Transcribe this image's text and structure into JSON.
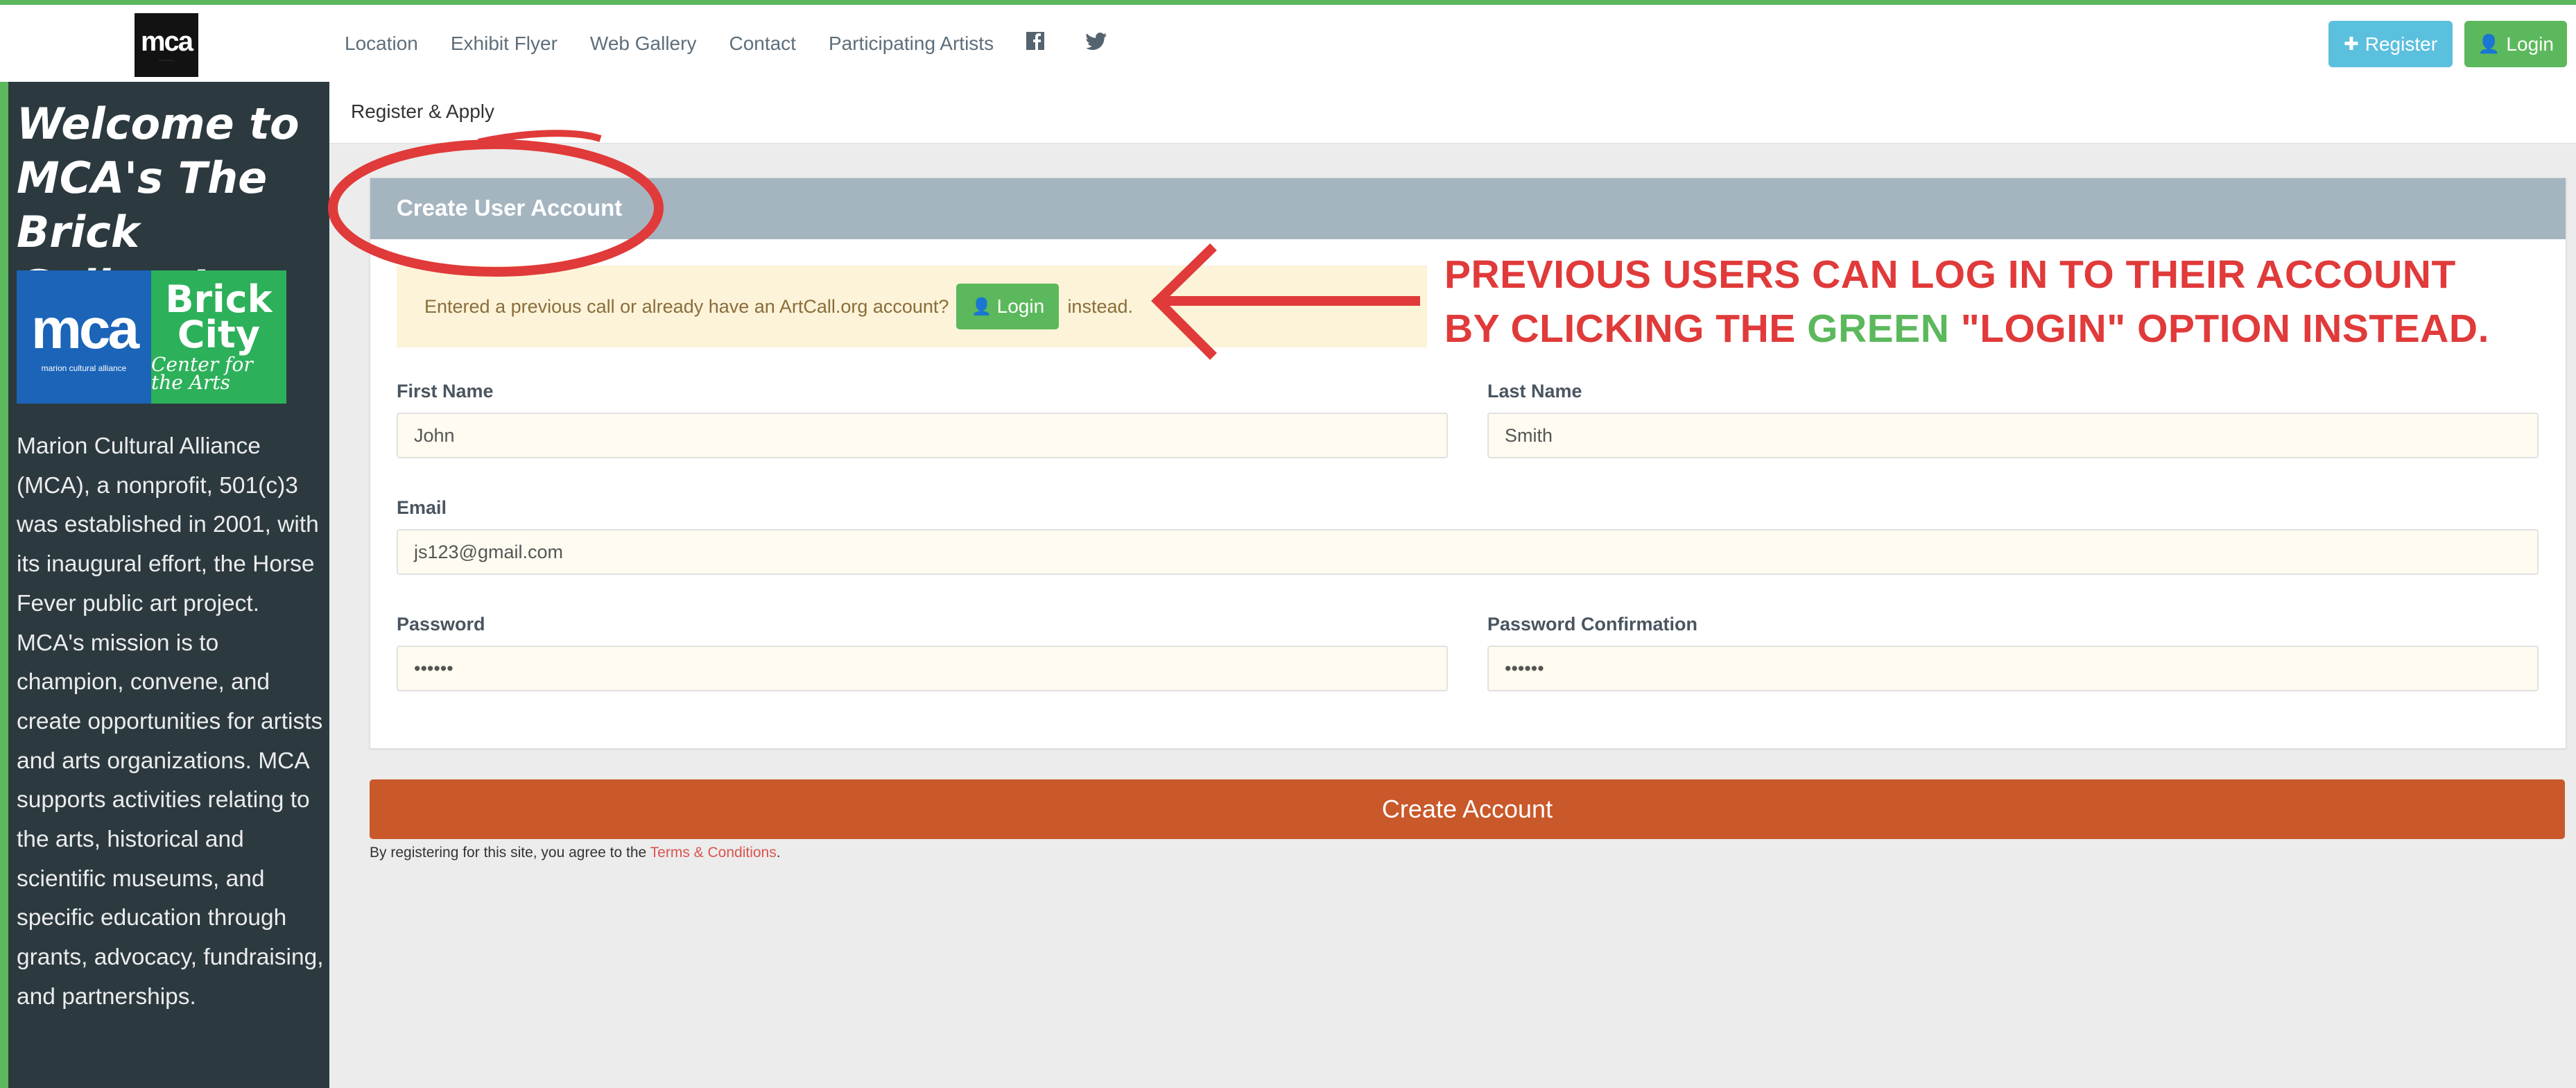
{
  "navbar": {
    "logo_text": "mca",
    "links": [
      "Location",
      "Exhibit Flyer",
      "Web Gallery",
      "Contact",
      "Participating Artists"
    ],
    "social_icons": [
      "facebook-icon",
      "twitter-icon"
    ],
    "register_label": "Register",
    "login_label": "Login"
  },
  "sidebar": {
    "title": "Welcome to MCA's The Brick Gallery!",
    "logo_mca": "mca",
    "logo_mca_sub": "marion cultural alliance",
    "logo_brick_1": "Brick",
    "logo_brick_2": "City",
    "logo_brick_3": "Center for the Arts",
    "description": "Marion Cultural Alliance (MCA), a nonprofit, 501(c)3 was established in 2001, with its inaugural effort, the Horse Fever public art project. MCA's mission is to champion, convene, and create opportunities for artists and arts organizations. MCA supports activities relating to the arts, historical and scientific museums, and specific education through grants, advocacy, fundraising, and partnerships."
  },
  "breadcrumb": "Register & Apply",
  "panel": {
    "title": "Create User Account",
    "notice_text": "Entered a previous call or already have an ArtCall.org account?",
    "notice_login": "Login",
    "notice_suffix": "instead."
  },
  "form": {
    "first_name_label": "First Name",
    "first_name_value": "John",
    "last_name_label": "Last Name",
    "last_name_value": "Smith",
    "email_label": "Email",
    "email_value": "js123@gmail.com",
    "password_label": "Password",
    "password_value": "••••••",
    "password_confirm_label": "Password Confirmation",
    "password_confirm_value": "••••••"
  },
  "create_button": "Create Account",
  "terms": {
    "prefix": "By registering for this site, you agree to the ",
    "link": "Terms & Conditions",
    "suffix": "."
  },
  "annotation": {
    "line1": "PREVIOUS USERS CAN LOG IN TO THEIR ACCOUNT",
    "line2_before": "BY CLICKING THE ",
    "line2_green": "GREEN",
    "line2_after": " \"LOGIN\" OPTION INSTEAD."
  },
  "colors": {
    "accent_green": "#5cb85c",
    "info_blue": "#5bc0de",
    "orange": "#c9582a",
    "annotation_red": "#e03a3a"
  }
}
